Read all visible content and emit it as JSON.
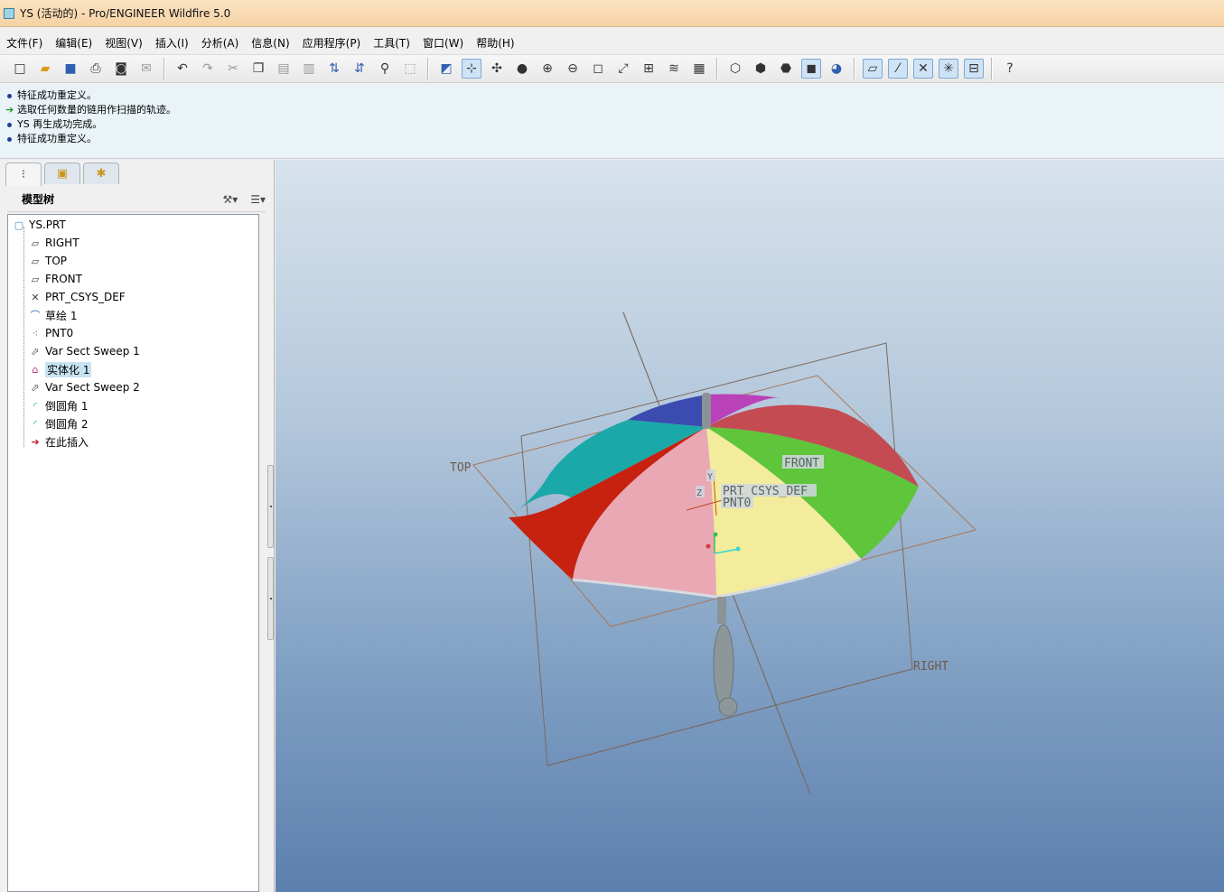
{
  "window": {
    "title": "YS (活动的) - Pro/ENGINEER Wildfire 5.0"
  },
  "menu": [
    "文件(F)",
    "编辑(E)",
    "视图(V)",
    "插入(I)",
    "分析(A)",
    "信息(N)",
    "应用程序(P)",
    "工具(T)",
    "窗口(W)",
    "帮助(H)"
  ],
  "toolbar": {
    "file_group": [
      "new-icon",
      "open-icon",
      "save-icon",
      "print-icon",
      "preview-icon",
      "email-icon"
    ],
    "edit_group": [
      "undo-icon",
      "redo-icon",
      "cut-icon",
      "copy-icon",
      "paste-icon",
      "paste-special-icon",
      "regenerate-icon",
      "regen-manager-icon",
      "find-icon",
      "select-box-icon"
    ],
    "view_group": [
      "repaint-icon",
      "spin-center-icon",
      "orient-icon",
      "appearance-icon",
      "zoom-in-icon",
      "zoom-out-icon",
      "refit-icon",
      "reorient-icon",
      "saved-views-icon",
      "layers-icon",
      "view-manager-icon"
    ],
    "display_group": [
      "wireframe-icon",
      "hidden-line-icon",
      "no-hidden-icon",
      "shading-icon",
      "enhanced-realism-icon"
    ],
    "datum_group": [
      "datum-planes-icon",
      "datum-axes-icon",
      "datum-points-icon",
      "csys-icon",
      "annotations-icon"
    ],
    "help_icon": "whats-this-icon"
  },
  "messages": [
    {
      "type": "info",
      "text": "特征成功重定义。"
    },
    {
      "type": "prompt",
      "text": "选取任何数量的链用作扫描的轨迹。"
    },
    {
      "type": "info",
      "text": "YS 再生成功完成。"
    },
    {
      "type": "info",
      "text": "特征成功重定义。"
    }
  ],
  "model_tree": {
    "title": "模型树",
    "root": "YS.PRT",
    "items": [
      {
        "label": "RIGHT",
        "icon": "datum-plane-icon"
      },
      {
        "label": "TOP",
        "icon": "datum-plane-icon"
      },
      {
        "label": "FRONT",
        "icon": "datum-plane-icon"
      },
      {
        "label": "PRT_CSYS_DEF",
        "icon": "csys-icon"
      },
      {
        "label": "草绘 1",
        "icon": "sketch-icon"
      },
      {
        "label": "PNT0",
        "icon": "datum-point-icon"
      },
      {
        "label": "Var Sect Sweep 1",
        "icon": "sweep-icon"
      },
      {
        "label": "实体化 1",
        "icon": "solidify-icon",
        "selected": true
      },
      {
        "label": "Var Sect Sweep 2",
        "icon": "sweep-icon"
      },
      {
        "label": "倒圆角 1",
        "icon": "round-icon"
      },
      {
        "label": "倒圆角 2",
        "icon": "round-icon"
      },
      {
        "label": "在此插入",
        "icon": "insert-here-icon"
      }
    ]
  },
  "viewport": {
    "labels": {
      "top": "TOP",
      "front": "FRONT",
      "right": "RIGHT",
      "csys": "PRT_CSYS_DEF",
      "point": "PNT0",
      "axis_y": "Y",
      "axis_z": "Z"
    },
    "colors": {
      "background_top": "#d7e2ec",
      "background_bottom": "#5d7fae",
      "datum_plane": "#b07a5a",
      "panels": [
        "#c7210f",
        "#e9a8b3",
        "#f2ec9c",
        "#5fc53a",
        "#c44b52",
        "#b942b8",
        "#3b4bb0",
        "#1aa8a8"
      ]
    }
  }
}
